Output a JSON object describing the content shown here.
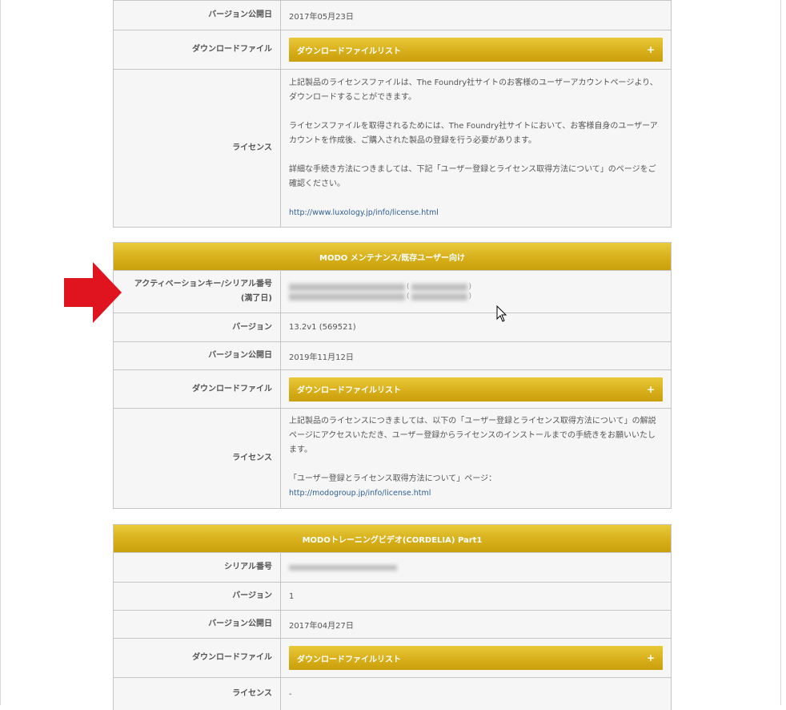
{
  "table1": {
    "version_date_label": "バージョン公開日",
    "version_date_value": "2017年05月23日",
    "download_label": "ダウンロードファイル",
    "download_button": "ダウンロードファイルリスト",
    "license_label": "ライセンス",
    "license_para1": "上記製品のライセンスファイルは、The Foundry社サイトのお客様のユーザーアカウントページより、ダウンロードすることができます。",
    "license_para2": "ライセンスファイルを取得されるためには、The Foundry社サイトにおいて、お客様自身のユーザーアカウントを作成後、ご購入された製品の登録を行う必要があります。",
    "license_para3": "詳細な手続き方法につきましては、下記「ユーザー登録とライセンス取得方法について」のページをご確認ください。",
    "license_link": "http://www.luxology.jp/info/license.html"
  },
  "table2": {
    "title": "MODO メンテナンス/既存ユーザー向け",
    "activation_label_line1": "アクティベーションキー/シリアル番号",
    "activation_label_line2": "(満了日)",
    "version_label": "バージョン",
    "version_value": "13.2v1 (569521)",
    "version_date_label": "バージョン公開日",
    "version_date_value": "2019年11月12日",
    "download_label": "ダウンロードファイル",
    "download_button": "ダウンロードファイルリスト",
    "license_label": "ライセンス",
    "license_para1": "上記製品のライセンスにつきましては、以下の「ユーザー登録とライセンス取得方法について」の解説ページにアクセスいただき、ユーザー登録からライセンスのインストールまでの手続きをお願いいたします。",
    "license_para2": "「ユーザー登録とライセンス取得方法について」ページ：",
    "license_link": "http://modogroup.jp/info/license.html"
  },
  "table3": {
    "title": "MODOトレーニングビデオ(CORDELIA) Part1",
    "serial_label": "シリアル番号",
    "version_label": "バージョン",
    "version_value": "1",
    "version_date_label": "バージョン公開日",
    "version_date_value": "2017年04月27日",
    "download_label": "ダウンロードファイル",
    "download_button": "ダウンロードファイルリスト",
    "license_label": "ライセンス",
    "license_value": "-"
  },
  "icons": {
    "expand": "+",
    "open_paren": "(",
    "close_paren": ")"
  },
  "colors": {
    "header_gold": "#d9b21e",
    "arrow_red": "#e0141e",
    "link_blue": "#2f5f94"
  }
}
